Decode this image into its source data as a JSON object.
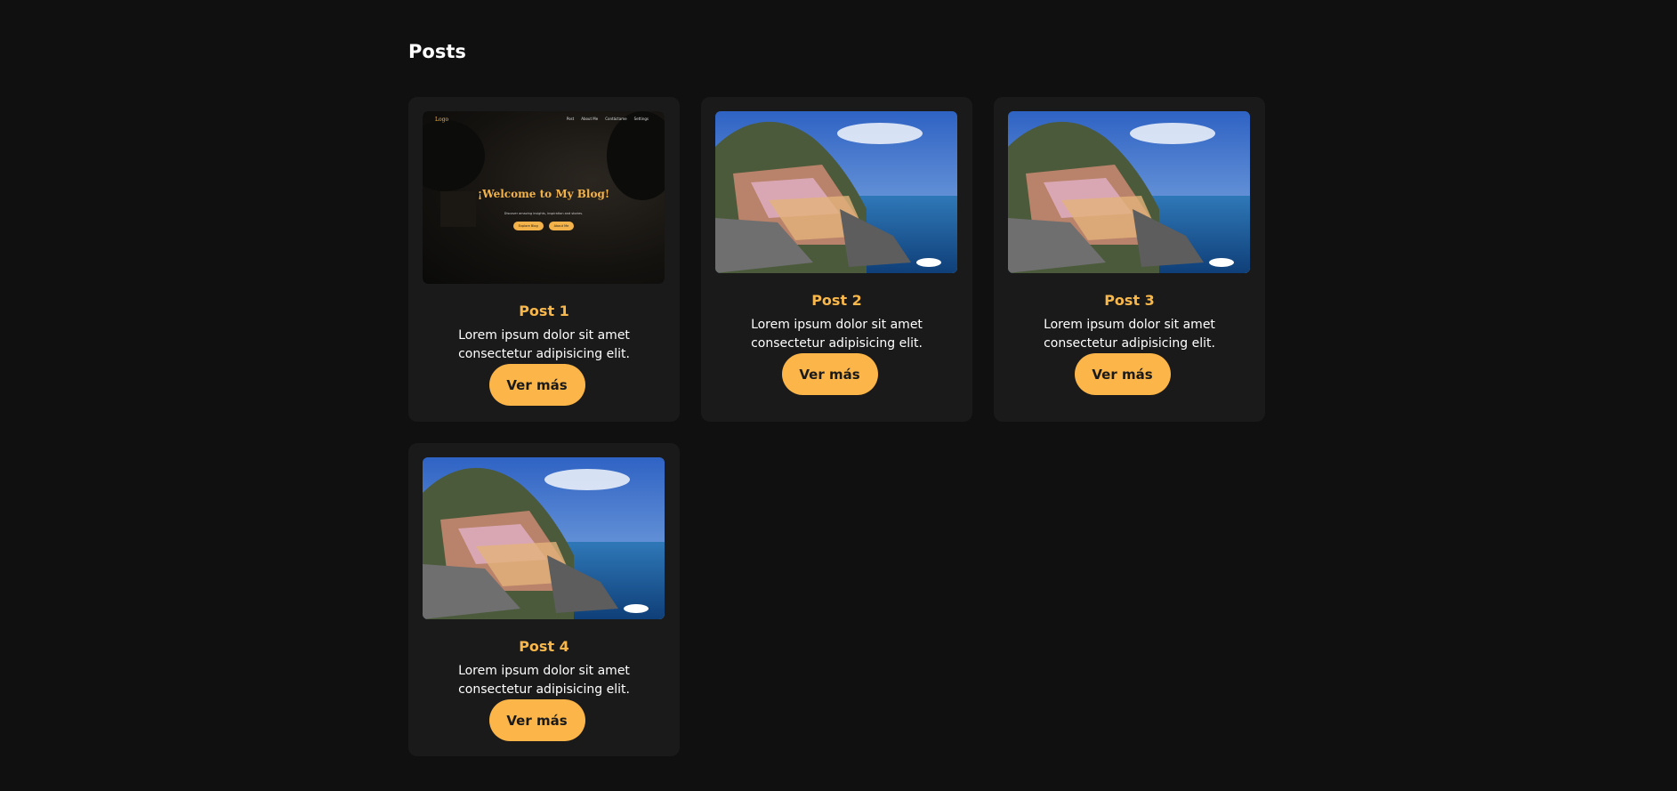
{
  "section": {
    "title": "Posts"
  },
  "colors": {
    "background": "#101010",
    "card": "#1a1a1a",
    "accent": "#fbb548",
    "title": "#f7b74a"
  },
  "posts": [
    {
      "title": "Post 1",
      "text": "Lorem ipsum dolor sit amet consectetur adipisicing elit.",
      "button": "Ver más",
      "image": {
        "kind": "blog-screenshot",
        "logo": "Logo",
        "nav": [
          "Post",
          "About Me",
          "Contáctame",
          "Settings"
        ],
        "headline": "¡Welcome to My Blog!",
        "tagline": "Discover amazing insights, inspiration and stories.",
        "buttons": [
          "Explore Blog",
          "About Me"
        ]
      }
    },
    {
      "title": "Post 2",
      "text": "Lorem ipsum dolor sit amet consectetur adipisicing elit.",
      "button": "Ver más",
      "image": {
        "kind": "coastal-village-photo"
      }
    },
    {
      "title": "Post 3",
      "text": "Lorem ipsum dolor sit amet consectetur adipisicing elit.",
      "button": "Ver más",
      "image": {
        "kind": "coastal-village-photo"
      }
    },
    {
      "title": "Post 4",
      "text": "Lorem ipsum dolor sit amet consectetur adipisicing elit.",
      "button": "Ver más",
      "image": {
        "kind": "coastal-village-photo"
      }
    }
  ]
}
